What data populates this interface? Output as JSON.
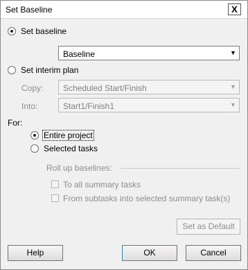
{
  "dialog": {
    "title": "Set Baseline",
    "close_glyph": "X"
  },
  "set_baseline": {
    "label": "Set baseline",
    "selected": true,
    "dropdown_value": "Baseline"
  },
  "set_interim": {
    "label": "Set interim plan",
    "selected": false,
    "copy_label": "Copy:",
    "copy_value": "Scheduled Start/Finish",
    "into_label": "Into:",
    "into_value": "Start1/Finish1"
  },
  "for": {
    "label": "For:",
    "entire_project": "Entire project",
    "selected_tasks": "Selected tasks",
    "selected": "entire_project"
  },
  "rollup": {
    "label": "Roll up baselines:",
    "option_summary": "To all summary tasks",
    "option_subtasks": "From subtasks into selected summary task(s)"
  },
  "buttons": {
    "set_default": "Set as Default",
    "help": "Help",
    "ok": "OK",
    "cancel": "Cancel"
  },
  "icons": {
    "dropdown_arrow": "chevron-down-icon",
    "close": "close-icon"
  }
}
